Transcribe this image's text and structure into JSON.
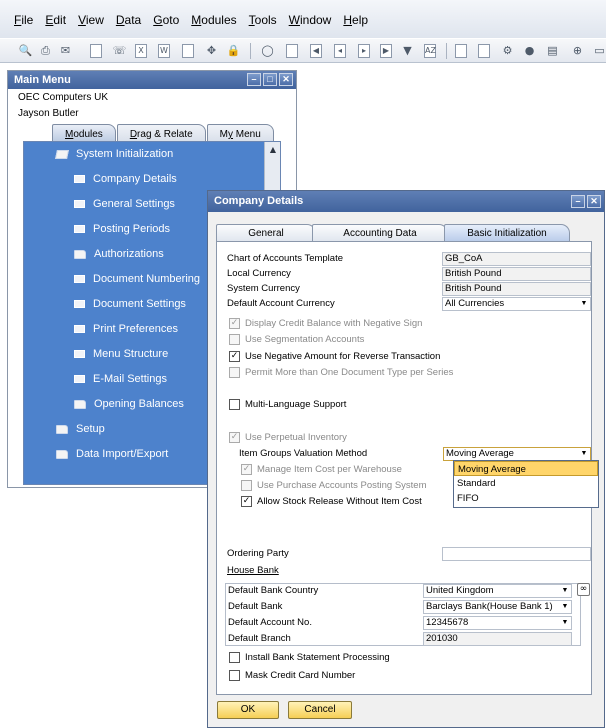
{
  "menubar": {
    "items": [
      {
        "label": "File",
        "u": "F",
        "rest": "ile"
      },
      {
        "label": "Edit",
        "u": "E",
        "rest": "dit"
      },
      {
        "label": "View",
        "u": "V",
        "rest": "iew"
      },
      {
        "label": "Data",
        "u": "D",
        "rest": "ata"
      },
      {
        "label": "Goto",
        "u": "G",
        "rest": "oto"
      },
      {
        "label": "Modules",
        "u": "M",
        "rest": "odules"
      },
      {
        "label": "Tools",
        "u": "T",
        "rest": "ools"
      },
      {
        "label": "Window",
        "u": "W",
        "rest": "indow"
      },
      {
        "label": "Help",
        "u": "H",
        "rest": "elp"
      }
    ]
  },
  "toolbar": {
    "icons": [
      "print-preview-icon",
      "print-icon",
      "email-icon",
      "pdf-icon",
      "fax-icon",
      "excel-icon",
      "word-icon",
      "launch-app-icon",
      "cursor-icon",
      "lock-icon",
      "find-icon",
      "add-icon",
      "first-record-icon",
      "previous-record-icon",
      "next-record-icon",
      "last-record-icon",
      "filter-icon",
      "sort-icon",
      "base-document-icon",
      "target-document-icon",
      "settings-icon",
      "gross-profit-icon",
      "payment-means-icon",
      "volume-weight-icon"
    ]
  },
  "main_menu": {
    "title": "Main Menu",
    "company": "OEC Computers UK",
    "user": "Jayson Butler",
    "tabs": [
      {
        "label": "Modules",
        "u": "M",
        "rest": "odules"
      },
      {
        "label": "Drag & Relate",
        "u": "D",
        "rest": "rag & Relate"
      },
      {
        "label": "My Menu",
        "pre": "M",
        "u": "y",
        "rest": " Menu"
      }
    ],
    "items": [
      {
        "label": "System Initialization",
        "type": "folder-open"
      },
      {
        "label": "Company Details",
        "type": "doc"
      },
      {
        "label": "General Settings",
        "type": "doc"
      },
      {
        "label": "Posting Periods",
        "type": "doc"
      },
      {
        "label": "Authorizations",
        "type": "folder"
      },
      {
        "label": "Document Numbering",
        "type": "doc"
      },
      {
        "label": "Document Settings",
        "type": "doc"
      },
      {
        "label": "Print Preferences",
        "type": "doc"
      },
      {
        "label": "Menu Structure",
        "type": "doc"
      },
      {
        "label": "E-Mail Settings",
        "type": "doc"
      },
      {
        "label": "Opening Balances",
        "type": "folder"
      },
      {
        "label": "Setup",
        "type": "folder"
      },
      {
        "label": "Data Import/Export",
        "type": "folder"
      }
    ]
  },
  "company_details": {
    "title": "Company Details",
    "tabs": [
      "General",
      "Accounting Data",
      "Basic Initialization"
    ],
    "chart_of_accounts_label": "Chart of Accounts Template",
    "chart_of_accounts_value": "GB_CoA",
    "local_currency_label": "Local Currency",
    "local_currency_value": "British Pound",
    "system_currency_label": "System Currency",
    "system_currency_value": "British Pound",
    "default_account_currency_label": "Default Account Currency",
    "default_account_currency_value": "All Currencies",
    "display_credit_balance": "Display Credit Balance with Negative Sign",
    "use_segmentation": "Use Segmentation Accounts",
    "use_negative_amount": "Use Negative Amount for Reverse Transaction",
    "permit_more_doc_types": "Permit More than One Document Type per Series",
    "multi_language": "Multi-Language Support",
    "use_perpetual_inventory": "Use Perpetual Inventory",
    "item_groups_valuation_label": "Item Groups Valuation Method",
    "item_groups_valuation_value": "Moving Average",
    "valuation_options": [
      "Moving Average",
      "Standard",
      "FIFO"
    ],
    "manage_item_cost": "Manage Item Cost per Warehouse",
    "use_purchase_accounts": "Use Purchase Accounts Posting System",
    "allow_stock_release": "Allow Stock Release Without Item Cost",
    "ordering_party_label": "Ordering Party",
    "house_bank_label": "House Bank",
    "default_bank_country_label": "Default Bank Country",
    "default_bank_country_value": "United Kingdom",
    "default_bank_label": "Default Bank",
    "default_bank_value": "Barclays Bank(House Bank 1)",
    "default_account_no_label": "Default Account No.",
    "default_account_no_value": "12345678",
    "default_branch_label": "Default Branch",
    "default_branch_value": "201030",
    "install_bank_statement": "Install Bank Statement Processing",
    "mask_credit_card": "Mask Credit Card Number",
    "ok_label": "OK",
    "cancel_label": "Cancel"
  }
}
